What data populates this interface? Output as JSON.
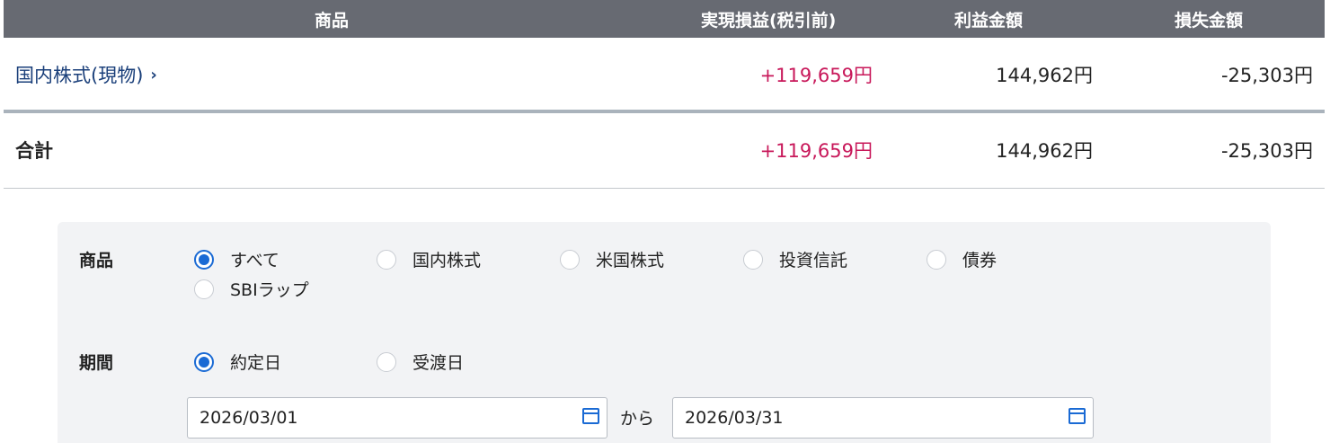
{
  "table": {
    "headers": {
      "product": "商品",
      "realized": "実現損益(税引前)",
      "profit": "利益金額",
      "loss": "損失金額"
    },
    "rows": [
      {
        "name": "国内株式(現物)",
        "chevron": "›",
        "realized": "+119,659円",
        "profit": "144,962円",
        "loss": "-25,303円"
      }
    ],
    "total": {
      "name": "合計",
      "realized": "+119,659円",
      "profit": "144,962円",
      "loss": "-25,303円"
    }
  },
  "filters": {
    "product": {
      "label": "商品",
      "options": [
        "すべて",
        "国内株式",
        "米国株式",
        "投資信託",
        "債券",
        "SBIラップ"
      ],
      "selected": "すべて"
    },
    "period": {
      "label": "期間",
      "options": [
        "約定日",
        "受渡日"
      ],
      "selected": "約定日",
      "from": "2026/03/01",
      "separator": "から",
      "to": "2026/03/31"
    }
  },
  "colors": {
    "header_bg": "#676a72",
    "positive": "#c8185a",
    "link": "#1a3f7a",
    "accent": "#1a6ad4",
    "panel_bg": "#f2f3f5"
  },
  "icons": [
    "chevron-right-icon",
    "calendar-icon"
  ]
}
